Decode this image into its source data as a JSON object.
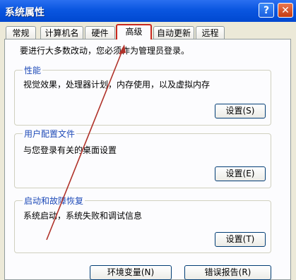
{
  "window": {
    "title": "系统属性",
    "help_icon": "question-icon",
    "close_icon": "close-icon"
  },
  "tabs": [
    {
      "label": "常规"
    },
    {
      "label": "计算机名"
    },
    {
      "label": "硬件"
    },
    {
      "label": "高级"
    },
    {
      "label": "自动更新"
    },
    {
      "label": "远程"
    }
  ],
  "active_tab": "高级",
  "info_text": "要进行大多数改动，您必须作为管理员登录。",
  "groups": {
    "performance": {
      "title": "性能",
      "desc": "视觉效果，处理器计划，内存使用，以及虚拟内存",
      "button": "设置(S)"
    },
    "profiles": {
      "title": "用户配置文件",
      "desc": "与您登录有关的桌面设置",
      "button": "设置(E)"
    },
    "startup": {
      "title": "启动和故障恢复",
      "desc": "系统启动，系统失败和调试信息",
      "button": "设置(T)"
    }
  },
  "bottom_buttons": {
    "env": "环境变量(N)",
    "error": "错误报告(R)"
  },
  "colors": {
    "titlebar": "#0A56E0",
    "highlight": "#C9281E",
    "annotation_arrow": "#B0322A"
  }
}
